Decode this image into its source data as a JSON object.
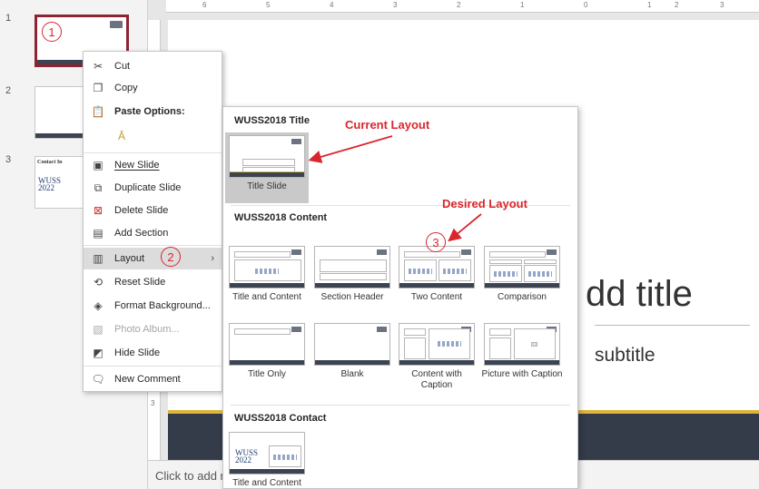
{
  "thumbnails": [
    {
      "number": "1",
      "selected": true
    },
    {
      "number": "2",
      "selected": false
    },
    {
      "number": "3",
      "selected": false,
      "mini_title": "Contact In",
      "mini_logo_text": "WUSS\n2022"
    }
  ],
  "annotations": {
    "step1": "1",
    "step2": "2",
    "step3": "3",
    "current_layout": "Current Layout",
    "desired_layout": "Desired Layout"
  },
  "context_menu": {
    "cut": "Cut",
    "copy": "Copy",
    "paste_options": "Paste Options:",
    "new_slide": "New Slide",
    "duplicate_slide": "Duplicate Slide",
    "delete_slide": "Delete Slide",
    "add_section": "Add Section",
    "layout": "Layout",
    "reset_slide": "Reset Slide",
    "format_background": "Format Background...",
    "photo_album": "Photo Album...",
    "hide_slide": "Hide Slide",
    "new_comment": "New Comment"
  },
  "gallery": {
    "sections": [
      {
        "title": "WUSS2018 Title",
        "layouts": [
          "Title Slide"
        ]
      },
      {
        "title": "WUSS2018 Content",
        "layouts": [
          "Title and Content",
          "Section Header",
          "Two Content",
          "Comparison",
          "Title Only",
          "Blank",
          "Content with Caption",
          "Picture with Caption"
        ]
      },
      {
        "title": "WUSS2018 Contact",
        "layouts": [
          "Title and Content"
        ]
      }
    ],
    "selected_layout": "Title Slide",
    "desired_layout": "Two Content"
  },
  "slide": {
    "title_placeholder": "dd title",
    "subtitle_placeholder": "subtitle"
  },
  "notes": {
    "placeholder": "Click to add n"
  },
  "ruler": {
    "top": [
      "6",
      "5",
      "4",
      "3",
      "2",
      "1",
      "0",
      "1",
      "2",
      "3"
    ],
    "left": [
      "3"
    ]
  },
  "colors": {
    "selection_border": "#8b2532",
    "annotation_red": "#d9262c",
    "slide_band": "#343c4a",
    "slide_gold": "#e0b43a"
  }
}
